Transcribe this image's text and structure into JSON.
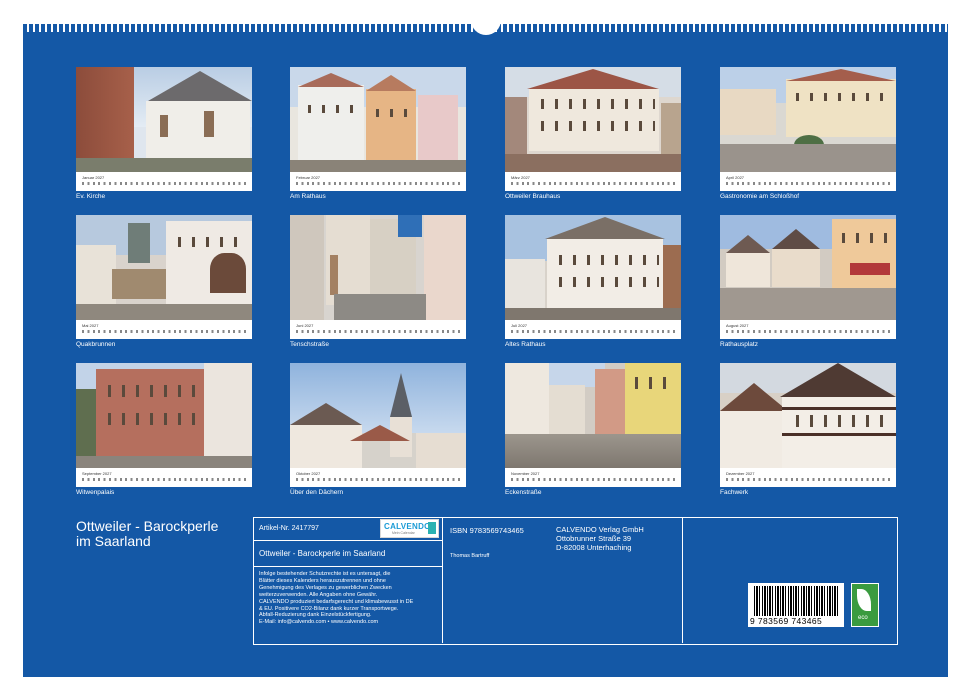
{
  "calendar_title": "Ottweiler - Barockperle im Saarland",
  "months": [
    {
      "month": "Januar 2027",
      "caption": "Ev. Kirche"
    },
    {
      "month": "Februar 2027",
      "caption": "Am Rathaus"
    },
    {
      "month": "März 2027",
      "caption": "Ottweiler Brauhaus"
    },
    {
      "month": "April 2027",
      "caption": "Gastronomie am Schloßhof"
    },
    {
      "month": "Mai 2027",
      "caption": "Quakbrunnen"
    },
    {
      "month": "Juni 2027",
      "caption": "Tenschstraße"
    },
    {
      "month": "Juli 2027",
      "caption": "Altes Rathaus"
    },
    {
      "month": "August 2027",
      "caption": "Rathausplatz"
    },
    {
      "month": "September 2027",
      "caption": "Witwenpalais"
    },
    {
      "month": "Oktober 2027",
      "caption": "Über den Dächern"
    },
    {
      "month": "November 2027",
      "caption": "Eckenstraße"
    },
    {
      "month": "Dezember 2027",
      "caption": "Fachwerk"
    }
  ],
  "info": {
    "article_no": "Artikel-Nr. 2417797",
    "product_title": "Ottweiler - Barockperle im Saarland",
    "isbn": "ISBN 9783569743465",
    "author": "Thomas Bartruff",
    "publisher_name": "CALVENDO Verlag GmbH",
    "publisher_street": "Ottobrunner Straße 39",
    "publisher_city": "D-82008 Unterhaching",
    "legal_lines": [
      "Infolge bestehender Schutzrechte ist es untersagt, die",
      "Blätter dieses Kalenders herauszutrennen und ohne",
      "Genehmigung des Verlages zu gewerblichen Zwecken",
      "weiterzuverwenden. Alle Angaben ohne Gewähr.",
      "CALVENDO produziert bedarfsgerecht und klimabewusst in DE",
      "& EU. Positivere CO2-Bilanz dank kurzer Transportwege.",
      "Abfall-Reduzierung dank Einzelstückfertigung.",
      "E-Mail: info@calvendo.com • www.calvendo.com"
    ],
    "logo_word": "CALVENDO",
    "logo_tagline": "Mein Calendar",
    "barcode_number": "9 783569 743465",
    "eco_label": "eco"
  },
  "colors": {
    "background": "#1458a6",
    "text": "#ffffff"
  }
}
